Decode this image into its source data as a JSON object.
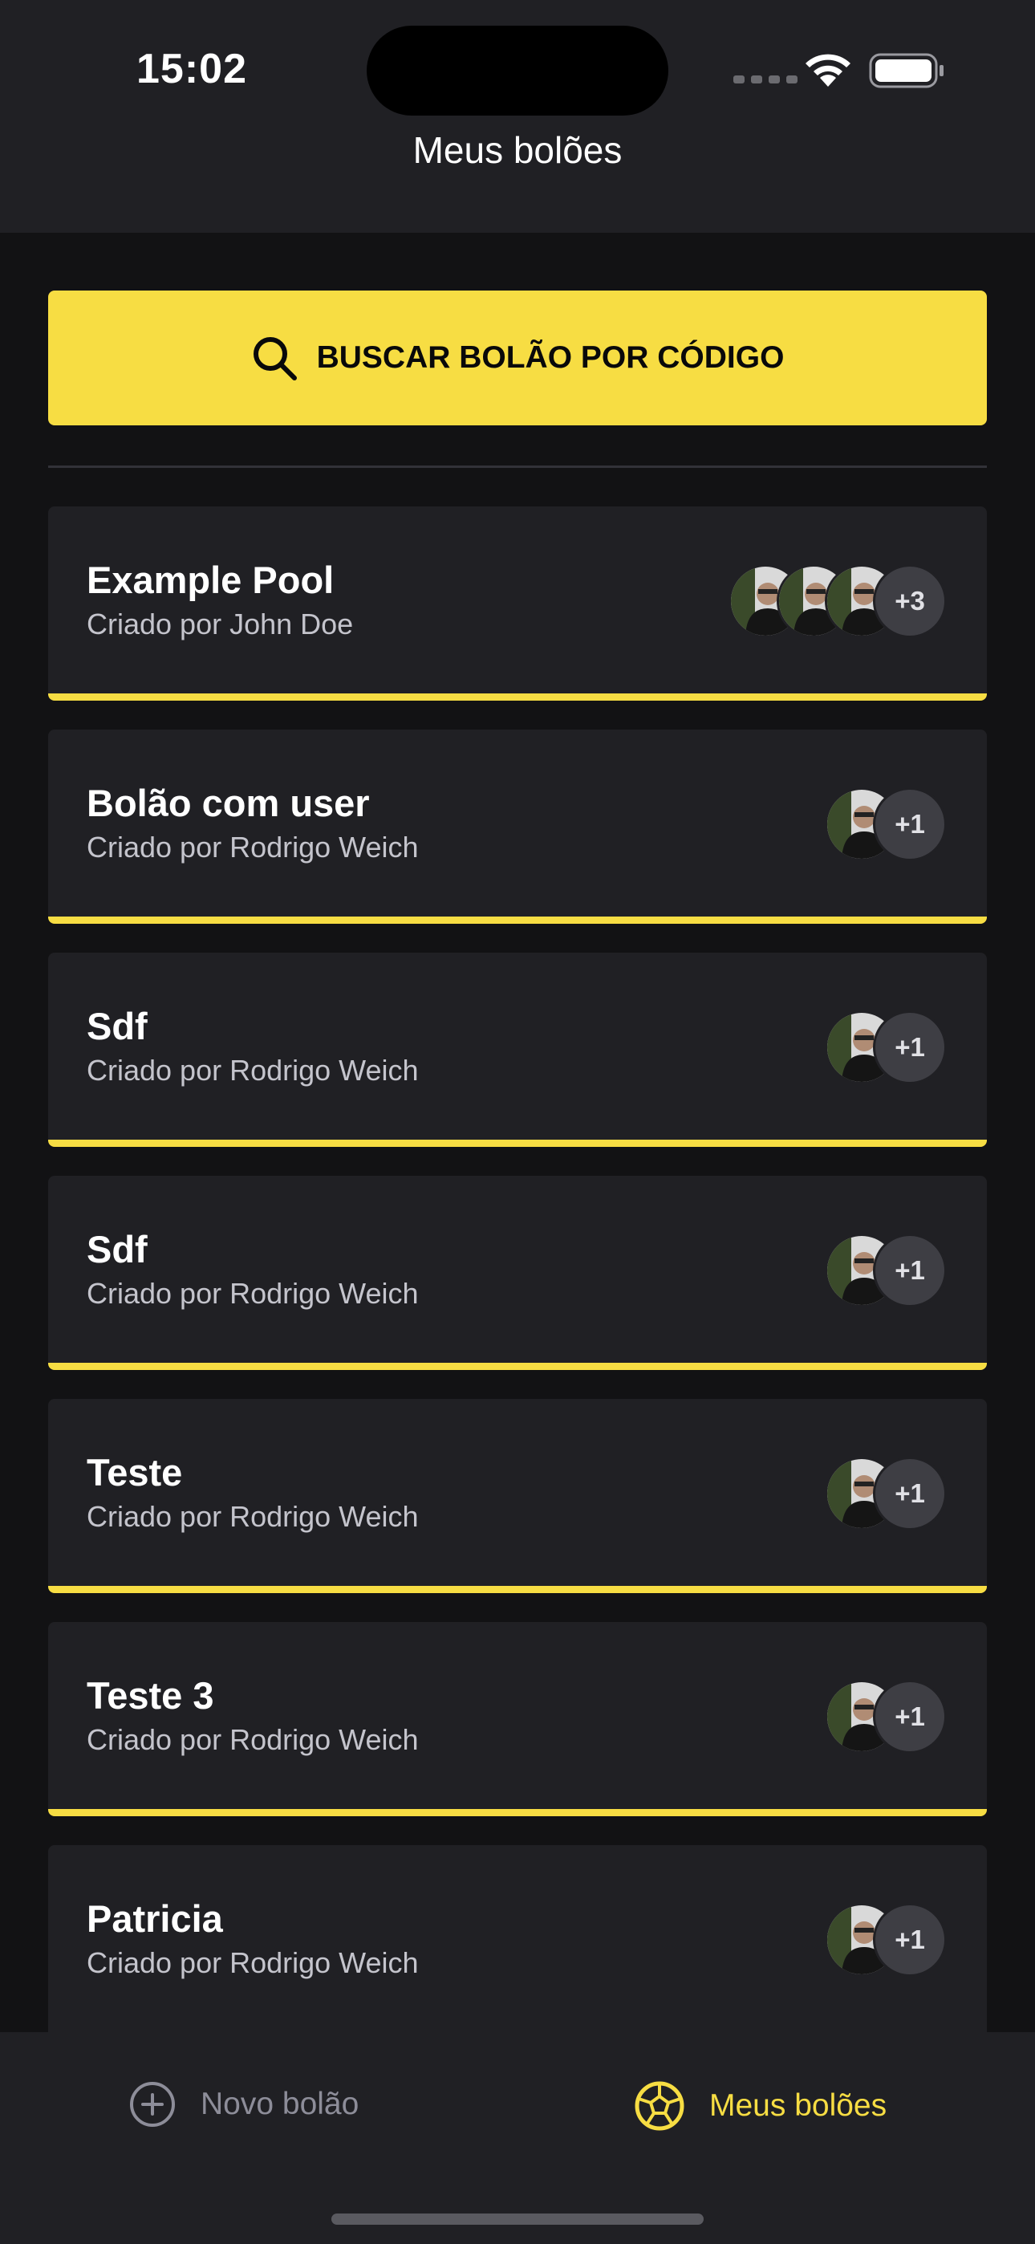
{
  "status_bar": {
    "time": "15:02"
  },
  "header": {
    "title": "Meus bolões"
  },
  "search": {
    "label": "BUSCAR BOLÃO POR CÓDIGO"
  },
  "pools": [
    {
      "title": "Example Pool",
      "owner": "Criado por John Doe",
      "avatars": 3,
      "extra": "+3"
    },
    {
      "title": "Bolão com user",
      "owner": "Criado por Rodrigo Weich",
      "avatars": 1,
      "extra": "+1"
    },
    {
      "title": "Sdf",
      "owner": "Criado por Rodrigo Weich",
      "avatars": 1,
      "extra": "+1"
    },
    {
      "title": "Sdf",
      "owner": "Criado por Rodrigo Weich",
      "avatars": 1,
      "extra": "+1"
    },
    {
      "title": "Teste",
      "owner": "Criado por Rodrigo Weich",
      "avatars": 1,
      "extra": "+1"
    },
    {
      "title": "Teste 3",
      "owner": "Criado por Rodrigo Weich",
      "avatars": 1,
      "extra": "+1"
    },
    {
      "title": "Patricia",
      "owner": "Criado por Rodrigo Weich",
      "avatars": 1,
      "extra": "+1"
    }
  ],
  "tab_bar": {
    "new_pool": {
      "label": "Novo bolão",
      "icon": "plus-circle-icon"
    },
    "my_pools": {
      "label": "Meus bolões",
      "icon": "soccer-ball-icon",
      "active": true
    }
  },
  "colors": {
    "accent": "#f7dd43",
    "background": "#121214",
    "surface": "#202024",
    "muted": "#8d8d99"
  }
}
